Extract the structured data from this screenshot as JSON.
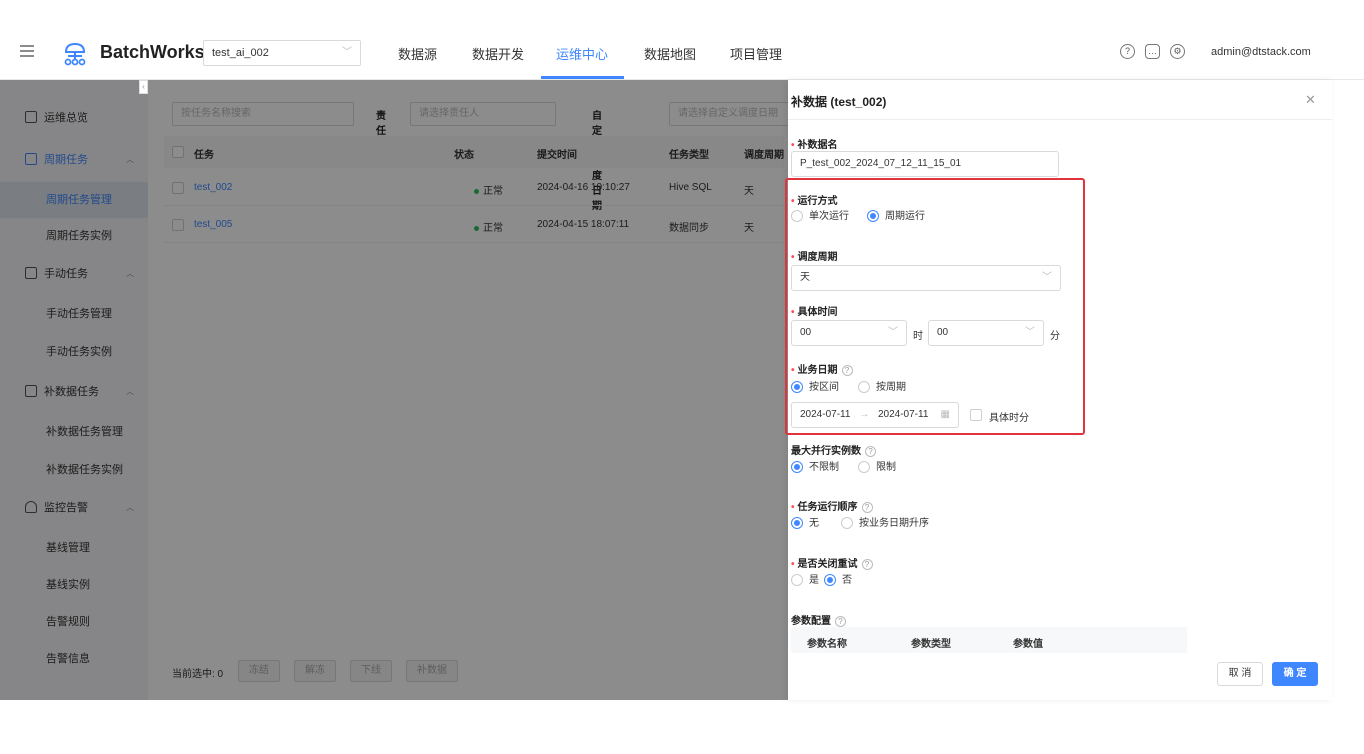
{
  "header": {
    "brand": "BatchWorks",
    "project": "test_ai_002",
    "nav": [
      "数据源",
      "数据开发",
      "运维中心",
      "数据地图",
      "项目管理"
    ],
    "user": "admin@dtstack.com",
    "icons": [
      "help-icon",
      "message-icon",
      "settings-icon"
    ]
  },
  "sidebar": {
    "items": [
      {
        "label": "运维总览"
      },
      {
        "label": "周期任务"
      },
      {
        "label": "周期任务管理"
      },
      {
        "label": "周期任务实例"
      },
      {
        "label": "手动任务"
      },
      {
        "label": "手动任务管理"
      },
      {
        "label": "手动任务实例"
      },
      {
        "label": "补数据任务"
      },
      {
        "label": "补数据任务管理"
      },
      {
        "label": "补数据任务实例"
      },
      {
        "label": "监控告警"
      },
      {
        "label": "基线管理"
      },
      {
        "label": "基线实例"
      },
      {
        "label": "告警规则"
      },
      {
        "label": "告警信息"
      }
    ]
  },
  "main": {
    "search_placeholder": "按任务名称搜索",
    "owner_label": "责任人",
    "owner_placeholder": "请选择责任人",
    "date_label": "自定义调度日期",
    "date_placeholder": "请选择自定义调度日期",
    "columns": [
      "任务",
      "状态",
      "提交时间",
      "任务类型",
      "调度周期"
    ],
    "rows": [
      {
        "name": "test_002",
        "status": "正常",
        "time": "2024-04-16 10:10:27",
        "type": "Hive SQL",
        "cycle": "天"
      },
      {
        "name": "test_005",
        "status": "正常",
        "time": "2024-04-15 18:07:11",
        "type": "数据同步",
        "cycle": "天"
      }
    ],
    "selected_count": "当前选中: 0",
    "bottom_buttons": [
      "冻结",
      "解冻",
      "下线",
      "补数据"
    ]
  },
  "drawer": {
    "title": "补数据 (test_002)",
    "name_label": "补数据名",
    "name_value": "P_test_002_2024_07_12_11_15_01",
    "run_mode_label": "运行方式",
    "run_mode_options": [
      "单次运行",
      "周期运行"
    ],
    "cycle_label": "调度周期",
    "cycle_value": "天",
    "time_label": "具体时间",
    "hour_value": "00",
    "hour_unit": "时",
    "minute_value": "00",
    "minute_unit": "分",
    "biz_date_label": "业务日期",
    "biz_date_options": [
      "按区间",
      "按周期"
    ],
    "start_date": "2024-07-11",
    "end_date": "2024-07-11",
    "specific_time_label": "具体时分",
    "max_parallel_label": "最大并行实例数",
    "max_parallel_options": [
      "不限制",
      "限制"
    ],
    "order_label": "任务运行顺序",
    "order_options": [
      "无",
      "按业务日期升序"
    ],
    "retry_label": "是否关闭重试",
    "retry_options": [
      "是",
      "否"
    ],
    "param_label": "参数配置",
    "param_columns": [
      "参数名称",
      "参数类型",
      "参数值"
    ],
    "cancel": "取 消",
    "ok": "确 定"
  }
}
